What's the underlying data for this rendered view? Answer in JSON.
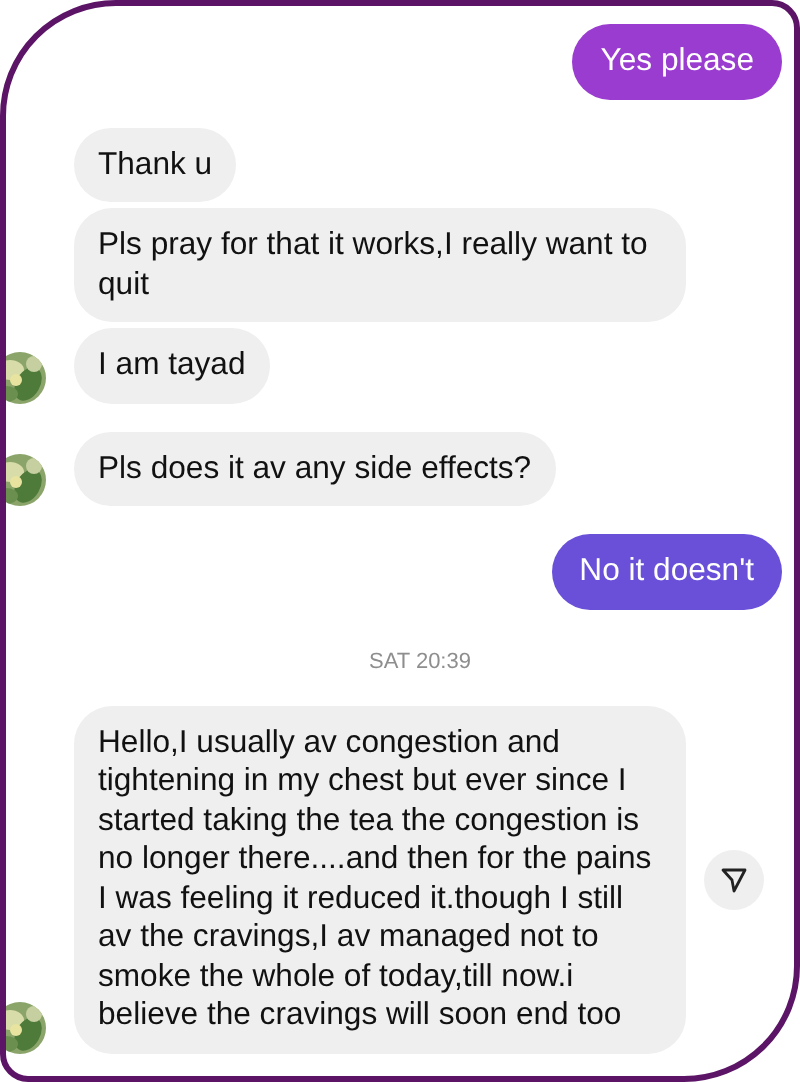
{
  "messages": [
    {
      "kind": "sent",
      "text": "Yes please",
      "color": "#9a3ccf"
    },
    {
      "kind": "received",
      "text": "Thank u",
      "avatar": false
    },
    {
      "kind": "received",
      "text": "Pls pray for that it works,I really want to quit",
      "avatar": false
    },
    {
      "kind": "received",
      "text": "I am tayad",
      "avatar": true
    },
    {
      "kind": "received",
      "text": "Pls does it av any side effects?",
      "avatar": true
    },
    {
      "kind": "sent",
      "text": "No it doesn't",
      "color": "#6a50d8"
    },
    {
      "kind": "timestamp",
      "text": "SAT 20:39"
    },
    {
      "kind": "received",
      "text": "Hello,I usually av congestion and tightening in my chest but ever since I started taking the tea the congestion is no longer there....and then for the pains I was feeling it reduced it.though I still av the cravings,I av managed not to smoke the whole of today,till now.i believe the cravings will soon end too",
      "avatar": true,
      "share": true
    }
  ]
}
